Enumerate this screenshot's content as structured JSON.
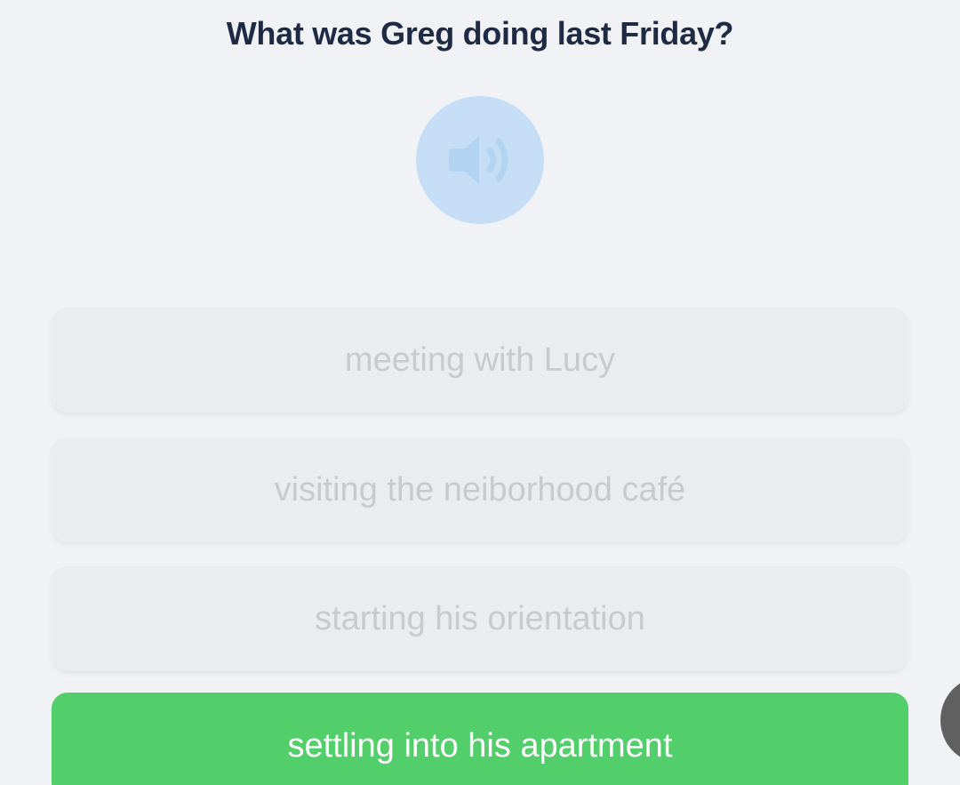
{
  "question": {
    "text": "What was Greg doing last Friday?"
  },
  "audio": {
    "icon": "speaker-icon",
    "color": "#c6def5",
    "icon_color": "#b3d4f1"
  },
  "options": [
    {
      "label": "meeting with Lucy",
      "state": "disabled"
    },
    {
      "label": "visiting the neiborhood café",
      "state": "disabled"
    },
    {
      "label": "starting his orientation",
      "state": "disabled"
    },
    {
      "label": "settling into his apartment",
      "state": "selected"
    }
  ],
  "colors": {
    "selected": "#52cf6a",
    "disabled_bg": "#ebecee",
    "disabled_text": "#c9cacd",
    "title": "#1f2a44"
  }
}
